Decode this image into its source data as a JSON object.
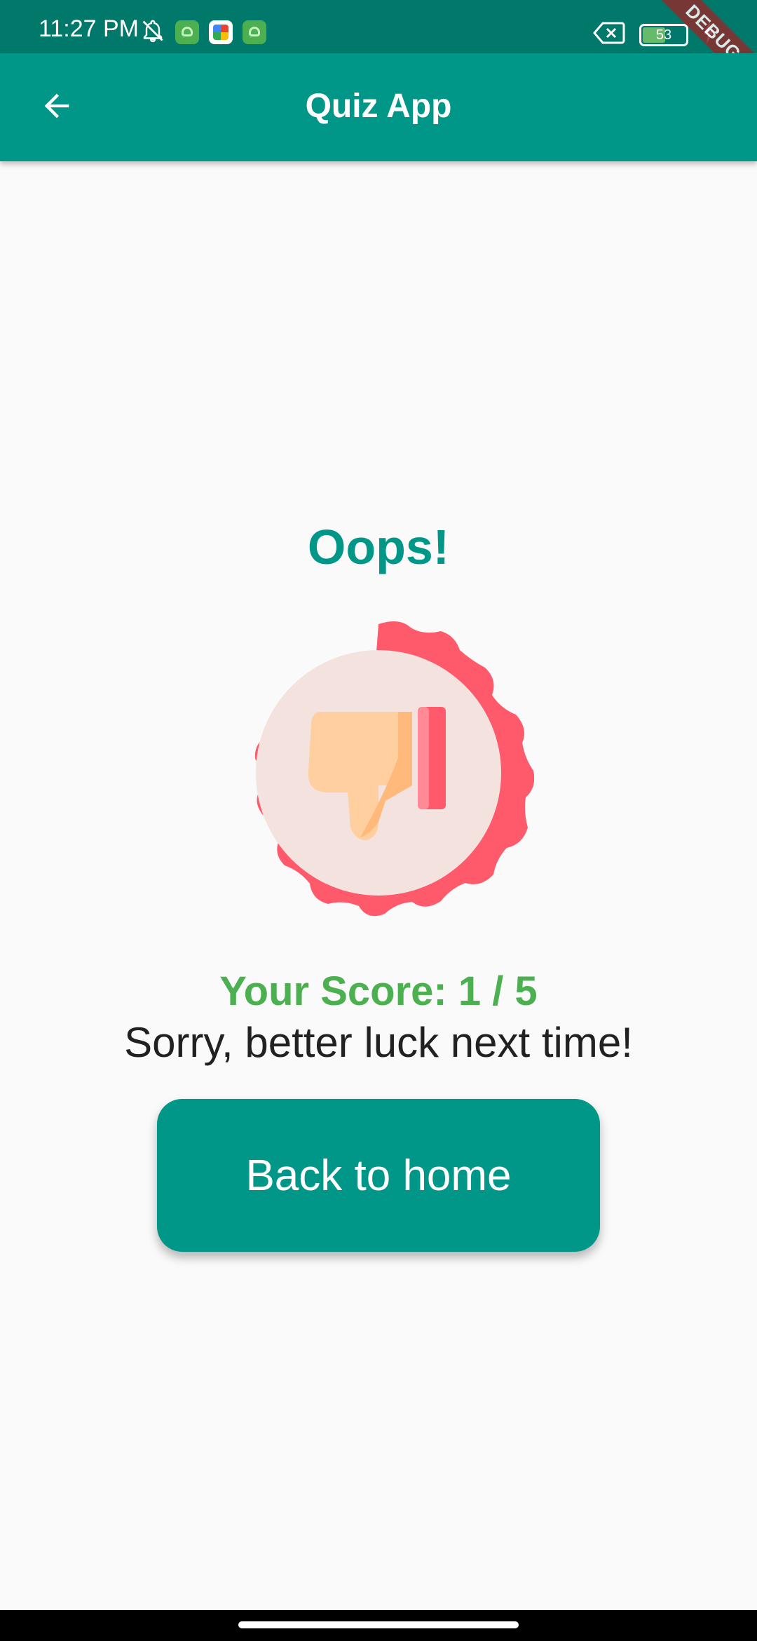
{
  "status_bar": {
    "time": "11:27 PM",
    "battery_level": "53",
    "battery_fraction": 0.53,
    "notification_icons": [
      "bell-off-icon",
      "app-notification-icon",
      "photos-icon",
      "app-notification-icon"
    ],
    "right_icons": [
      "no-sim-icon",
      "battery-icon",
      "charging-icon"
    ],
    "debug_banner": "DEBUG"
  },
  "app_bar": {
    "title": "Quiz App",
    "back_icon": "arrow-back-icon"
  },
  "result": {
    "heading": "Oops!",
    "badge_icon": "thumbs-down-badge-icon",
    "score": "Your Score: 1 / 5",
    "message": "Sorry, better luck next time!"
  },
  "actions": {
    "home_button_label": "Back to home"
  },
  "colors": {
    "primary": "#009688",
    "primary_dark": "#00796b",
    "score_green": "#4caf50",
    "badge_red": "#ff5a6b",
    "background": "#fafafa"
  }
}
